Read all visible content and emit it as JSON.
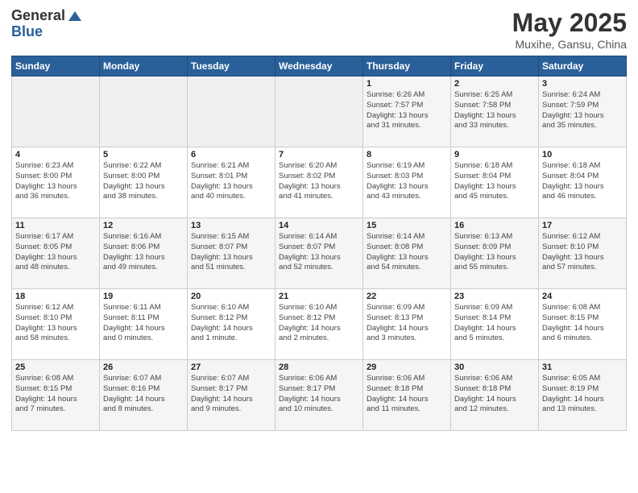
{
  "header": {
    "logo_general": "General",
    "logo_blue": "Blue",
    "month_title": "May 2025",
    "location": "Muxihe, Gansu, China"
  },
  "days_of_week": [
    "Sunday",
    "Monday",
    "Tuesday",
    "Wednesday",
    "Thursday",
    "Friday",
    "Saturday"
  ],
  "weeks": [
    [
      {
        "day": "",
        "info": ""
      },
      {
        "day": "",
        "info": ""
      },
      {
        "day": "",
        "info": ""
      },
      {
        "day": "",
        "info": ""
      },
      {
        "day": "1",
        "info": "Sunrise: 6:26 AM\nSunset: 7:57 PM\nDaylight: 13 hours\nand 31 minutes."
      },
      {
        "day": "2",
        "info": "Sunrise: 6:25 AM\nSunset: 7:58 PM\nDaylight: 13 hours\nand 33 minutes."
      },
      {
        "day": "3",
        "info": "Sunrise: 6:24 AM\nSunset: 7:59 PM\nDaylight: 13 hours\nand 35 minutes."
      }
    ],
    [
      {
        "day": "4",
        "info": "Sunrise: 6:23 AM\nSunset: 8:00 PM\nDaylight: 13 hours\nand 36 minutes."
      },
      {
        "day": "5",
        "info": "Sunrise: 6:22 AM\nSunset: 8:00 PM\nDaylight: 13 hours\nand 38 minutes."
      },
      {
        "day": "6",
        "info": "Sunrise: 6:21 AM\nSunset: 8:01 PM\nDaylight: 13 hours\nand 40 minutes."
      },
      {
        "day": "7",
        "info": "Sunrise: 6:20 AM\nSunset: 8:02 PM\nDaylight: 13 hours\nand 41 minutes."
      },
      {
        "day": "8",
        "info": "Sunrise: 6:19 AM\nSunset: 8:03 PM\nDaylight: 13 hours\nand 43 minutes."
      },
      {
        "day": "9",
        "info": "Sunrise: 6:18 AM\nSunset: 8:04 PM\nDaylight: 13 hours\nand 45 minutes."
      },
      {
        "day": "10",
        "info": "Sunrise: 6:18 AM\nSunset: 8:04 PM\nDaylight: 13 hours\nand 46 minutes."
      }
    ],
    [
      {
        "day": "11",
        "info": "Sunrise: 6:17 AM\nSunset: 8:05 PM\nDaylight: 13 hours\nand 48 minutes."
      },
      {
        "day": "12",
        "info": "Sunrise: 6:16 AM\nSunset: 8:06 PM\nDaylight: 13 hours\nand 49 minutes."
      },
      {
        "day": "13",
        "info": "Sunrise: 6:15 AM\nSunset: 8:07 PM\nDaylight: 13 hours\nand 51 minutes."
      },
      {
        "day": "14",
        "info": "Sunrise: 6:14 AM\nSunset: 8:07 PM\nDaylight: 13 hours\nand 52 minutes."
      },
      {
        "day": "15",
        "info": "Sunrise: 6:14 AM\nSunset: 8:08 PM\nDaylight: 13 hours\nand 54 minutes."
      },
      {
        "day": "16",
        "info": "Sunrise: 6:13 AM\nSunset: 8:09 PM\nDaylight: 13 hours\nand 55 minutes."
      },
      {
        "day": "17",
        "info": "Sunrise: 6:12 AM\nSunset: 8:10 PM\nDaylight: 13 hours\nand 57 minutes."
      }
    ],
    [
      {
        "day": "18",
        "info": "Sunrise: 6:12 AM\nSunset: 8:10 PM\nDaylight: 13 hours\nand 58 minutes."
      },
      {
        "day": "19",
        "info": "Sunrise: 6:11 AM\nSunset: 8:11 PM\nDaylight: 14 hours\nand 0 minutes."
      },
      {
        "day": "20",
        "info": "Sunrise: 6:10 AM\nSunset: 8:12 PM\nDaylight: 14 hours\nand 1 minute."
      },
      {
        "day": "21",
        "info": "Sunrise: 6:10 AM\nSunset: 8:12 PM\nDaylight: 14 hours\nand 2 minutes."
      },
      {
        "day": "22",
        "info": "Sunrise: 6:09 AM\nSunset: 8:13 PM\nDaylight: 14 hours\nand 3 minutes."
      },
      {
        "day": "23",
        "info": "Sunrise: 6:09 AM\nSunset: 8:14 PM\nDaylight: 14 hours\nand 5 minutes."
      },
      {
        "day": "24",
        "info": "Sunrise: 6:08 AM\nSunset: 8:15 PM\nDaylight: 14 hours\nand 6 minutes."
      }
    ],
    [
      {
        "day": "25",
        "info": "Sunrise: 6:08 AM\nSunset: 8:15 PM\nDaylight: 14 hours\nand 7 minutes."
      },
      {
        "day": "26",
        "info": "Sunrise: 6:07 AM\nSunset: 8:16 PM\nDaylight: 14 hours\nand 8 minutes."
      },
      {
        "day": "27",
        "info": "Sunrise: 6:07 AM\nSunset: 8:17 PM\nDaylight: 14 hours\nand 9 minutes."
      },
      {
        "day": "28",
        "info": "Sunrise: 6:06 AM\nSunset: 8:17 PM\nDaylight: 14 hours\nand 10 minutes."
      },
      {
        "day": "29",
        "info": "Sunrise: 6:06 AM\nSunset: 8:18 PM\nDaylight: 14 hours\nand 11 minutes."
      },
      {
        "day": "30",
        "info": "Sunrise: 6:06 AM\nSunset: 8:18 PM\nDaylight: 14 hours\nand 12 minutes."
      },
      {
        "day": "31",
        "info": "Sunrise: 6:05 AM\nSunset: 8:19 PM\nDaylight: 14 hours\nand 13 minutes."
      }
    ]
  ]
}
